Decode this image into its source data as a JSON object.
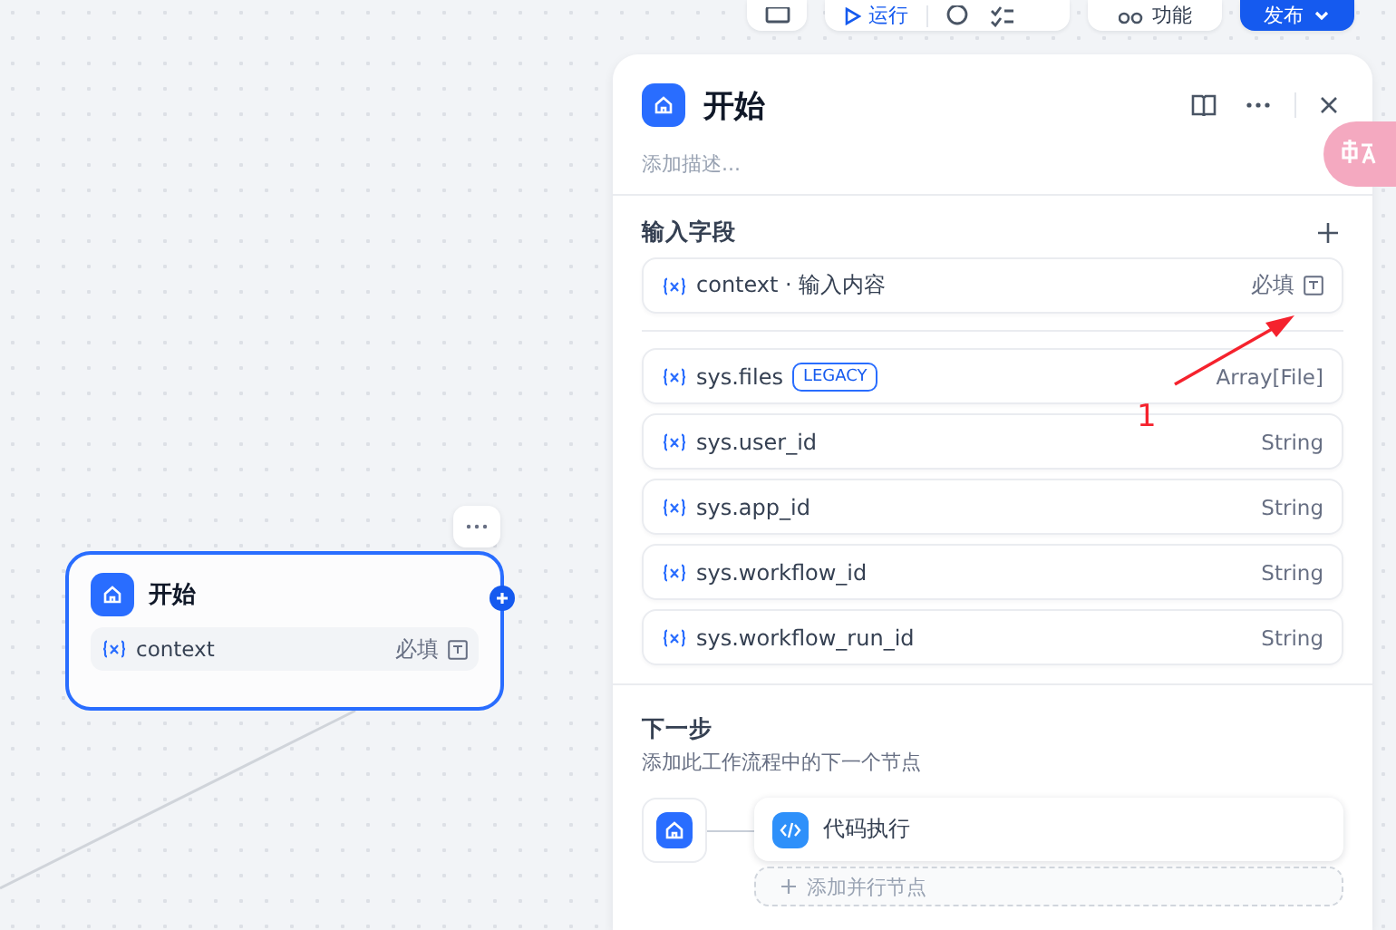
{
  "toolbar": {
    "run_label": "运行",
    "features_label": "功能",
    "publish_label": "发布"
  },
  "canvas": {
    "node": {
      "title": "开始",
      "variables": [
        {
          "name": "context",
          "required_label": "必填"
        }
      ]
    }
  },
  "panel": {
    "title": "开始",
    "description_placeholder": "添加描述...",
    "input_fields": {
      "heading": "输入字段",
      "user_fields": [
        {
          "name": "context · 输入内容",
          "required_label": "必填"
        }
      ],
      "system_fields": [
        {
          "name": "sys.files",
          "badge": "LEGACY",
          "type": "Array[File]"
        },
        {
          "name": "sys.user_id",
          "type": "String"
        },
        {
          "name": "sys.app_id",
          "type": "String"
        },
        {
          "name": "sys.workflow_id",
          "type": "String"
        },
        {
          "name": "sys.workflow_run_id",
          "type": "String"
        }
      ]
    },
    "next_step": {
      "heading": "下一步",
      "description": "添加此工作流程中的下一个节点",
      "nodes": [
        {
          "title": "代码执行"
        }
      ],
      "add_parallel_label": "添加并行节点"
    }
  },
  "annotations": [
    {
      "label": "1"
    }
  ]
}
